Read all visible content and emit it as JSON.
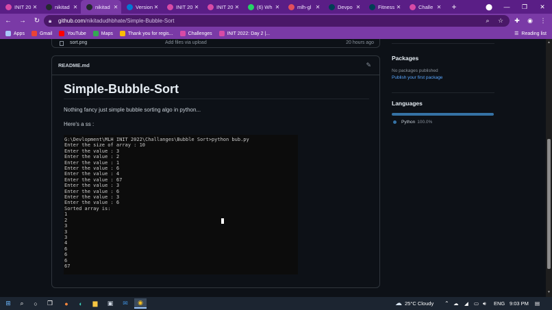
{
  "browser": {
    "tabs": [
      {
        "title": "INIT 20",
        "icon": "dev-icon",
        "color": "#d84aa6",
        "active": false
      },
      {
        "title": "nikitad",
        "icon": "github-icon",
        "color": "#24292f",
        "active": false
      },
      {
        "title": "nikitad",
        "icon": "github-icon",
        "color": "#24292f",
        "active": true
      },
      {
        "title": "Version",
        "icon": "vs-icon",
        "color": "#0078d4",
        "active": false
      },
      {
        "title": "INIT 20",
        "icon": "dev-icon",
        "color": "#d84aa6",
        "active": false
      },
      {
        "title": "INIT 20",
        "icon": "dev-icon",
        "color": "#d84aa6",
        "active": false
      },
      {
        "title": "(6) Wh",
        "icon": "whatsapp-icon",
        "color": "#25d366",
        "active": false
      },
      {
        "title": "mlh-gl",
        "icon": "github-icon",
        "color": "#e24f5c",
        "active": false
      },
      {
        "title": "Devpo",
        "icon": "devpost-icon",
        "color": "#003e54",
        "active": false
      },
      {
        "title": "Fitness",
        "icon": "devpost-icon",
        "color": "#003e54",
        "active": false
      },
      {
        "title": "Challe",
        "icon": "dev-icon",
        "color": "#d84aa6",
        "active": false
      }
    ],
    "url_host": "github.com",
    "url_path": "/nikitadudhbhate/Simple-Bubble-Sort",
    "bookmarks": [
      {
        "label": "Apps",
        "icon": "apps-grid-icon",
        "color": "#a8c7fa"
      },
      {
        "label": "Gmail",
        "icon": "gmail-icon",
        "color": "#ea4335"
      },
      {
        "label": "YouTube",
        "icon": "youtube-icon",
        "color": "#ff0000"
      },
      {
        "label": "Maps",
        "icon": "maps-icon",
        "color": "#34a853"
      },
      {
        "label": "Thank you for regis...",
        "icon": "form-icon",
        "color": "#fbbc04"
      },
      {
        "label": "Challenges",
        "icon": "dev-icon",
        "color": "#d84aa6"
      },
      {
        "label": "INIT 2022: Day 2 |...",
        "icon": "dev-icon",
        "color": "#d84aa6"
      }
    ],
    "reading_list": "Reading list"
  },
  "repo": {
    "file_row": {
      "name": "sort.png",
      "message": "Add files via upload",
      "time": "20 hours ago"
    },
    "readme_label": "README.md",
    "title": "Simple-Bubble-Sort",
    "description": "Nothing fancy just simple bubble sorting algo in python...",
    "ss_label": "Here's a ss :",
    "terminal_lines": [
      "G:\\Devlopment\\MLH INIT 2022\\Challanges\\Bubble Sort>python bub.py",
      "Enter the size of array : 10",
      "Enter the value : 3",
      "Enter the value : 2",
      "Enter the value : 1",
      "Enter the value : 6",
      "Enter the value : 4",
      "Enter the value : 67",
      "Enter the value : 3",
      "Enter the value : 6",
      "Enter the value : 3",
      "Enter the value : 6",
      "Sorted array is:",
      "1",
      "2",
      "3",
      "3",
      "3",
      "4",
      "6",
      "6",
      "6",
      "67"
    ],
    "packages": {
      "heading": "Packages",
      "empty": "No packages published",
      "link": "Publish your first package"
    },
    "languages": {
      "heading": "Languages",
      "items": [
        {
          "name": "Python",
          "percent": "100.0%",
          "color": "#3572a5"
        }
      ]
    }
  },
  "taskbar": {
    "weather": "25°C  Cloudy",
    "language": "ENG",
    "time": "9:03 PM"
  }
}
